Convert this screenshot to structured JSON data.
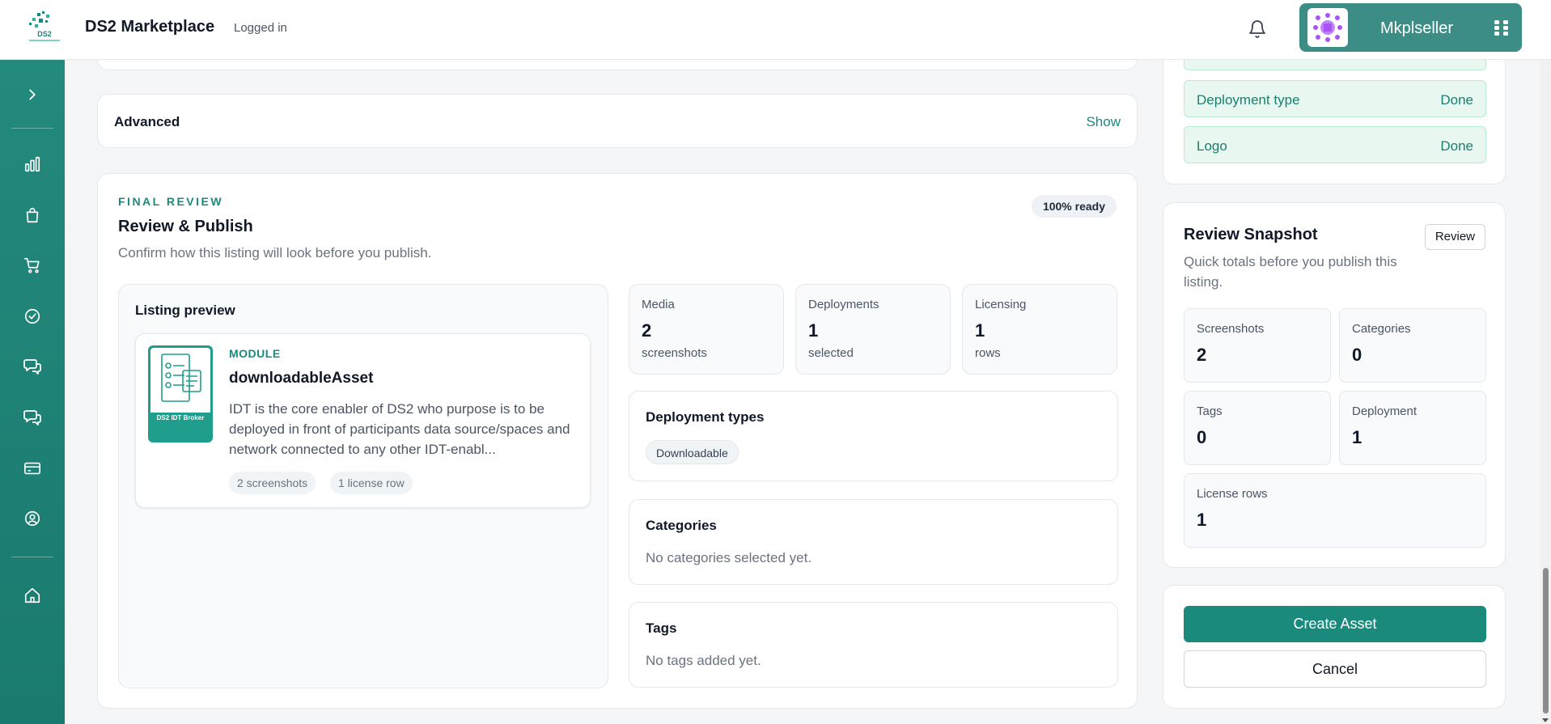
{
  "header": {
    "logo_text": "DS2",
    "app_title": "DS2 Marketplace",
    "login_status": "Logged in",
    "user_name": "Mkplseller",
    "bell_icon": "bell-icon",
    "apps_icon": "grid-dots-icon"
  },
  "sidebar": {
    "toggle_icon": "chevron-right-icon",
    "items": [
      {
        "name": "bar-chart-icon"
      },
      {
        "name": "shopping-bag-icon"
      },
      {
        "name": "cart-icon"
      },
      {
        "name": "check-circle-icon"
      },
      {
        "name": "chat-icon"
      },
      {
        "name": "chat-icon"
      },
      {
        "name": "credit-card-icon"
      },
      {
        "name": "user-circle-icon"
      },
      {
        "name": "home-icon"
      }
    ]
  },
  "advanced": {
    "title": "Advanced",
    "toggle_label": "Show"
  },
  "final_review": {
    "eyebrow": "FINAL REVIEW",
    "title": "Review & Publish",
    "subtitle": "Confirm how this listing will look before you publish.",
    "ready_badge": "100% ready",
    "preview": {
      "label": "Listing preview",
      "thumbnail_label": "DS2 IDT Broker",
      "type_tag": "MODULE",
      "asset_name": "downloadableAsset",
      "description": "IDT is the core enabler of DS2 who purpose is to be deployed in front of participants data source/spaces and network connected to any other IDT-enabl...",
      "chips": [
        "2 screenshots",
        "1 license row"
      ]
    },
    "stats": [
      {
        "label": "Media",
        "value": "2",
        "unit": "screenshots"
      },
      {
        "label": "Deployments",
        "value": "1",
        "unit": "selected"
      },
      {
        "label": "Licensing",
        "value": "1",
        "unit": "rows"
      }
    ],
    "deployment_types": {
      "title": "Deployment types",
      "chips": [
        "Downloadable"
      ]
    },
    "categories": {
      "title": "Categories",
      "empty_text": "No categories selected yet."
    },
    "tags": {
      "title": "Tags",
      "empty_text": "No tags added yet."
    }
  },
  "checklist": {
    "items": [
      {
        "label": "Deployment type",
        "status": "Done"
      },
      {
        "label": "Logo",
        "status": "Done"
      }
    ]
  },
  "snapshot": {
    "title": "Review Snapshot",
    "subtitle": "Quick totals before you publish this listing.",
    "review_button": "Review",
    "boxes": [
      {
        "label": "Screenshots",
        "value": "2"
      },
      {
        "label": "Categories",
        "value": "0"
      },
      {
        "label": "Tags",
        "value": "0"
      },
      {
        "label": "Deployment",
        "value": "1"
      },
      {
        "label": "License rows",
        "value": "1"
      }
    ]
  },
  "actions": {
    "create_label": "Create Asset",
    "cancel_label": "Cancel"
  },
  "colors": {
    "accent": "#1a8a7d",
    "sidebar": "#238a7d",
    "user_chip": "#3d8d87",
    "done_bg": "#e8f8f1"
  }
}
